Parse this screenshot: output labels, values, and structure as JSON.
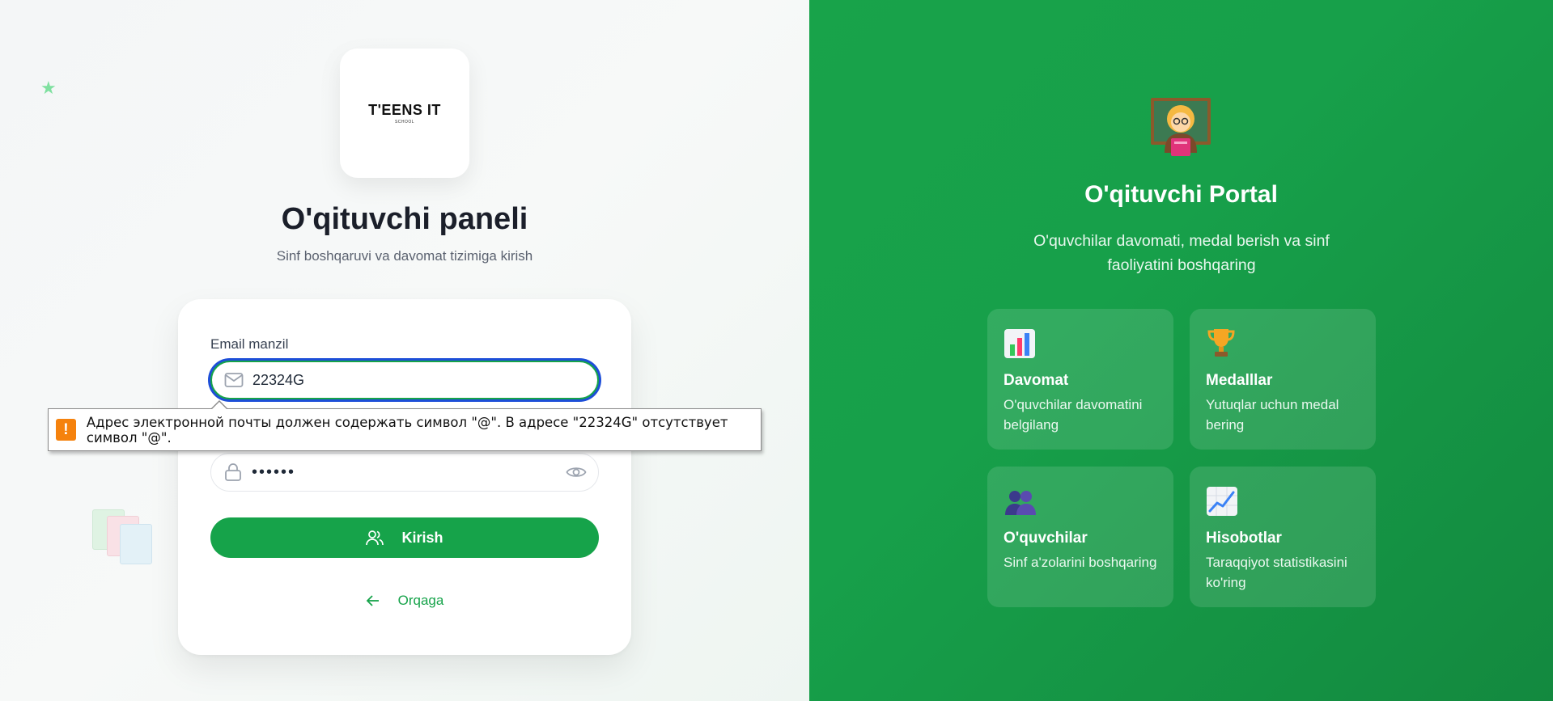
{
  "login": {
    "logo": {
      "brand": "T'EENS IT",
      "sub": "SCHOOL"
    },
    "title": "O'qituvchi paneli",
    "subtitle": "Sinf boshqaruvi va davomat tizimiga kirish",
    "email_label": "Email manzil",
    "email_value": "22324G",
    "password_value": "••••••",
    "login_button": "Kirish",
    "back_link": "Orqaga"
  },
  "validation_tooltip": {
    "message": "Адрес электронной почты должен содержать символ \"@\". В адресе \"22324G\" отсутствует символ \"@\".",
    "icon": "warning-icon"
  },
  "portal": {
    "title": "O'qituvchi Portal",
    "description": "O'quvchilar davomati, medal berish va sinf faoliyatini boshqaring",
    "features": [
      {
        "icon": "bar-chart-icon",
        "title": "Davomat",
        "text": "O'quvchilar davomatini belgilang"
      },
      {
        "icon": "trophy-icon",
        "title": "Medalllar",
        "text": "Yutuqlar uchun medal bering"
      },
      {
        "icon": "people-icon",
        "title": "O'quvchilar",
        "text": "Sinf a'zolarini boshqaring"
      },
      {
        "icon": "chart-increasing-icon",
        "title": "Hisobotlar",
        "text": "Taraqqiyot statistikasini ko'ring"
      }
    ]
  },
  "colors": {
    "primary_green": "#16a34a",
    "focus_ring": "#1d4ed8",
    "warning_orange": "#f5820d"
  }
}
